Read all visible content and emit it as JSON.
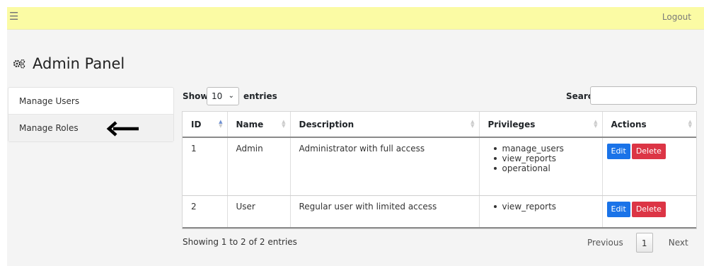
{
  "topbar": {
    "menu_icon": "hamburger-icon",
    "logout_label": "Logout"
  },
  "header": {
    "icon": "cogs-icon",
    "title": "Admin Panel"
  },
  "sidebar": {
    "items": [
      {
        "label": "Manage Users"
      },
      {
        "label": "Manage Roles"
      }
    ],
    "annotation_icon": "left-arrow-icon"
  },
  "controls": {
    "show_label": "Show",
    "entries_value": "10",
    "entries_label": "entries",
    "search_label": "Search:",
    "search_value": ""
  },
  "table": {
    "columns": [
      "ID",
      "Name",
      "Description",
      "Privileges",
      "Actions"
    ],
    "rows": [
      {
        "id": "1",
        "name": "Admin",
        "description": "Administrator with full access",
        "privileges": [
          "manage_users",
          "view_reports",
          "operational"
        ]
      },
      {
        "id": "2",
        "name": "User",
        "description": "Regular user with limited access",
        "privileges": [
          "view_reports"
        ]
      }
    ],
    "edit_label": "Edit",
    "delete_label": "Delete"
  },
  "footer": {
    "info": "Showing 1 to 2 of 2 entries",
    "previous_label": "Previous",
    "page": "1",
    "next_label": "Next"
  },
  "colors": {
    "topbar": "#fbfba4",
    "edit_button": "#1a73e8",
    "delete_button": "#dc3545"
  }
}
